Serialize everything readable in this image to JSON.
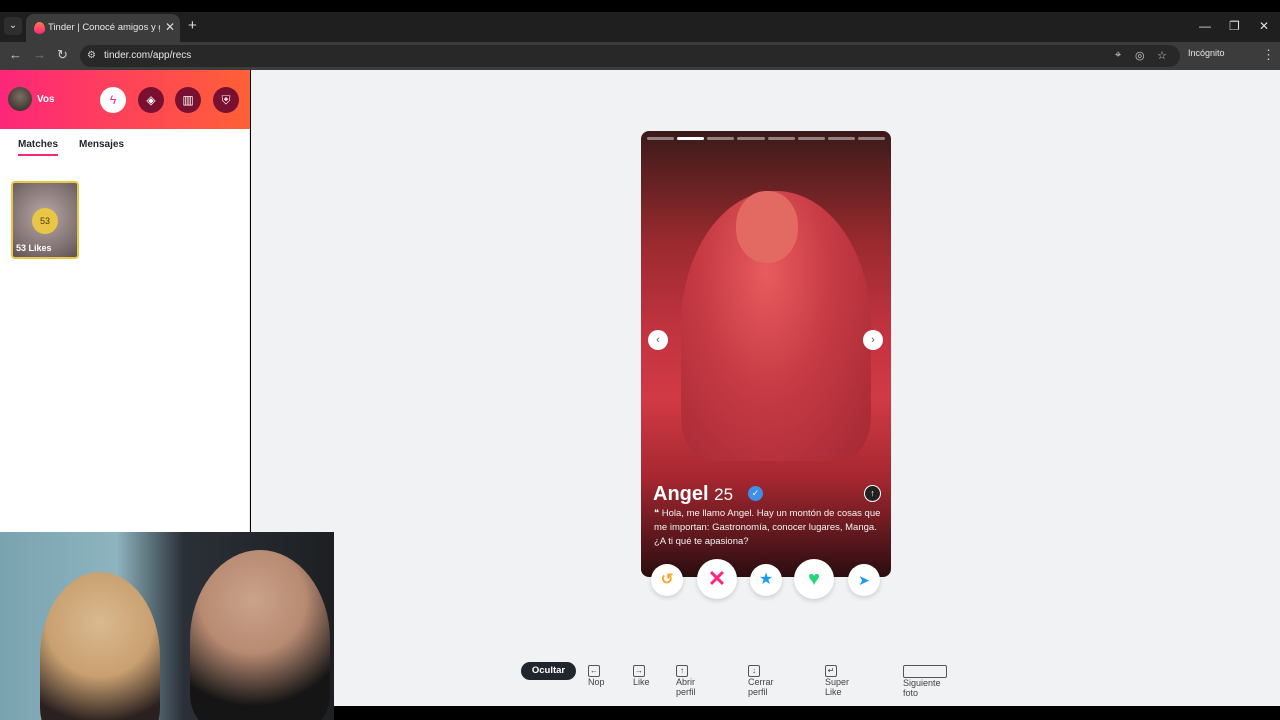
{
  "browser": {
    "tab_title": "Tinder | Conocé amigos y gente",
    "url": "tinder.com/app/recs",
    "incognito_label": "Incógnito",
    "new_tab": "+"
  },
  "sidebar": {
    "profile_name": "Vos",
    "tabs": [
      {
        "label": "Matches",
        "active": true
      },
      {
        "label": "Mensajes",
        "active": false
      }
    ],
    "likes_count": "53",
    "likes_label": "53 Likes"
  },
  "card": {
    "name": "Angel",
    "age": "25",
    "verified": true,
    "bio": "Hola, me llamo Angel. Hay un montón de cosas que me importan: Gastronomía, conocer lugares, Manga. ¿A ti qué te apasiona?",
    "photo_count": 8,
    "current_photo": 2
  },
  "actions": {
    "rewind_icon": "rewind-icon",
    "nope_icon": "close-icon",
    "super_like_icon": "star-icon",
    "like_icon": "heart-icon",
    "boost_icon": "send-icon"
  },
  "shortcuts": {
    "hide": "Ocultar",
    "nope": "Nop",
    "like": "Like",
    "open_profile": "Abrir perfil",
    "close_profile": "Cerrar perfil",
    "super_like": "Super Like",
    "next_photo": "Siguiente foto"
  },
  "colors": {
    "brand_gradient_start": "#fd267a",
    "brand_gradient_end": "#ff6036",
    "likes_gold": "#e9c645"
  }
}
